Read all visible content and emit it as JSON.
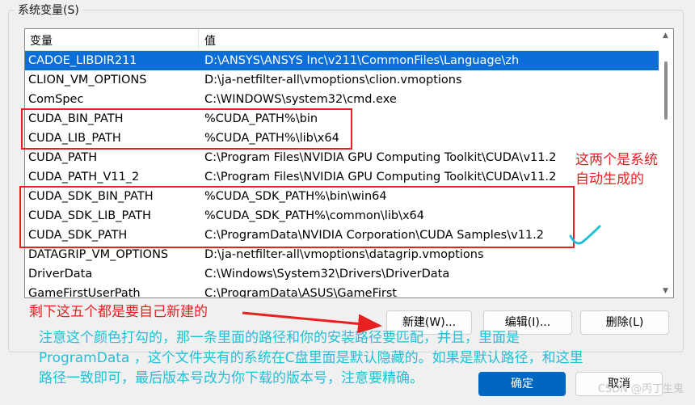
{
  "dialog": {
    "group_title": "系统变量(S)",
    "columns": {
      "name": "变量",
      "value": "值"
    },
    "rows": [
      {
        "name": "CADOE_LIBDIR211",
        "value": "D:\\ANSYS\\ANSYS Inc\\v211\\CommonFiles\\Language\\zh"
      },
      {
        "name": "CLION_VM_OPTIONS",
        "value": "D:\\ja-netfilter-all\\vmoptions\\clion.vmoptions"
      },
      {
        "name": "ComSpec",
        "value": "C:\\WINDOWS\\system32\\cmd.exe"
      },
      {
        "name": "CUDA_BIN_PATH",
        "value": "%CUDA_PATH%\\bin"
      },
      {
        "name": "CUDA_LIB_PATH",
        "value": "%CUDA_PATH%\\lib\\x64"
      },
      {
        "name": "CUDA_PATH",
        "value": "C:\\Program Files\\NVIDIA GPU Computing Toolkit\\CUDA\\v11.2"
      },
      {
        "name": "CUDA_PATH_V11_2",
        "value": "C:\\Program Files\\NVIDIA GPU Computing Toolkit\\CUDA\\v11.2"
      },
      {
        "name": "CUDA_SDK_BIN_PATH",
        "value": "%CUDA_SDK_PATH%\\bin\\win64"
      },
      {
        "name": "CUDA_SDK_LIB_PATH",
        "value": " %CUDA_SDK_PATH%\\common\\lib\\x64"
      },
      {
        "name": "CUDA_SDK_PATH",
        "value": "C:\\ProgramData\\NVIDIA Corporation\\CUDA Samples\\v11.2"
      },
      {
        "name": "DATAGRIP_VM_OPTIONS",
        "value": "D:\\ja-netfilter-all\\vmoptions\\datagrip.vmoptions"
      },
      {
        "name": "DriverData",
        "value": "C:\\Windows\\System32\\Drivers\\DriverData"
      },
      {
        "name": "GameFirstUserPath",
        "value": "C:\\ProgramData\\ASUS\\GameFirst"
      }
    ],
    "selected_row": 0,
    "buttons": {
      "new": "新建(W)...",
      "edit": "编辑(I)...",
      "delete": "删除(L)"
    },
    "footer_buttons": {
      "ok": "确定",
      "cancel": "取消"
    }
  },
  "annotations": {
    "auto_generated": [
      "这两个是系统",
      "自动生成的"
    ],
    "create_yourself": "剩下这五个都是要自己新建的",
    "instructions": [
      "注意这个颜色打勾的，那一条里面的路径和你的安装路径要匹配，并且，里面是",
      "ProgramData ，这个文件夹有的系统在C盘里面是默认隐藏的。如果是默认路径，和这里",
      "路径一致即可，最后版本号改为你下载的版本号，注意要精确。"
    ]
  },
  "watermark": "CSDN @丙丁生鬼",
  "colors": {
    "selection": "#0a6ed8",
    "annotation_red": "#e82020",
    "annotation_cyan": "#21c0d6",
    "primary_button": "#0067c0"
  }
}
